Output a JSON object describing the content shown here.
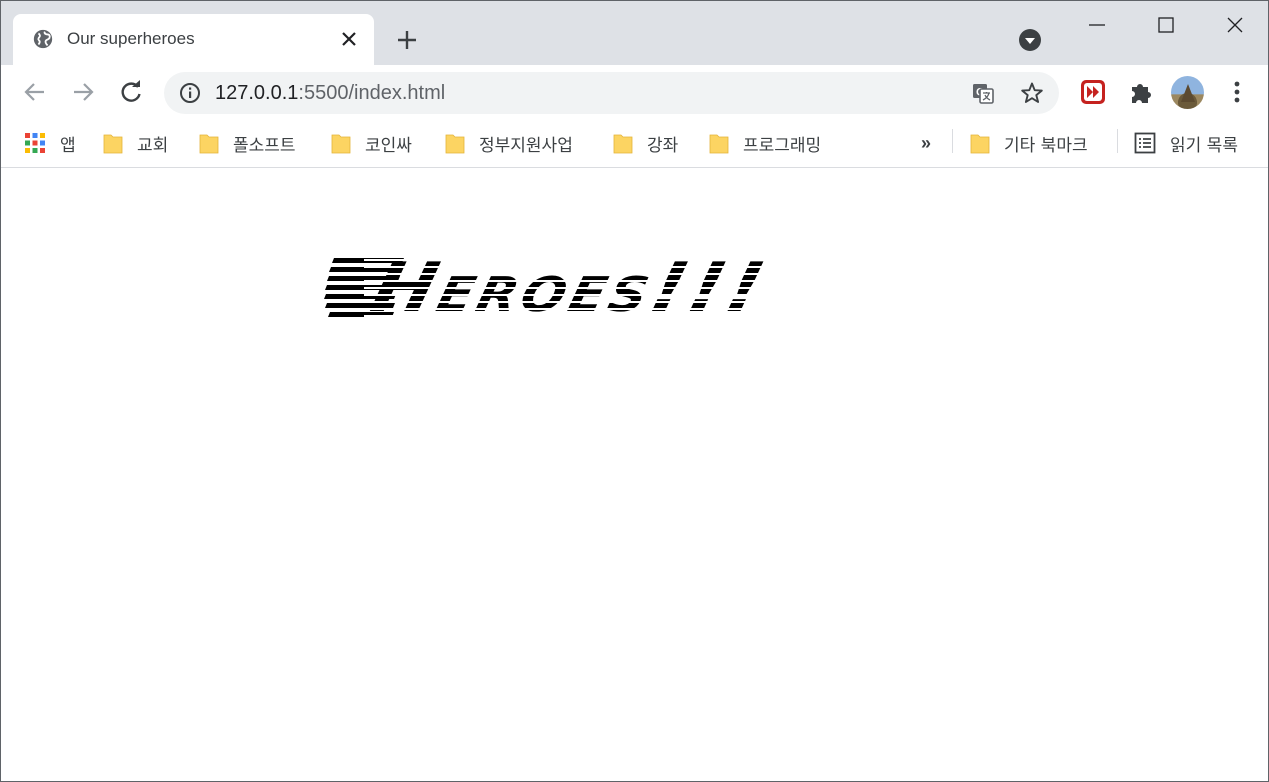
{
  "tab": {
    "title": "Our superheroes",
    "favicon": "globe-icon"
  },
  "window_controls": [
    "minimize-icon",
    "maximize-icon",
    "close-icon"
  ],
  "toolbar": {
    "url_host": "127.0.0.1",
    "url_rest": ":5500/index.html",
    "extensions": [
      "translate-icon",
      "star-icon",
      "video-speed-ext-icon",
      "puzzle-icon",
      "avatar",
      "kebab-menu-icon"
    ]
  },
  "bookmarks": {
    "apps_label": "앱",
    "items": [
      {
        "label": "교회"
      },
      {
        "label": "폴소프트"
      },
      {
        "label": "코인싸"
      },
      {
        "label": "정부지원사업"
      },
      {
        "label": "강좌"
      },
      {
        "label": "프로그래밍"
      }
    ],
    "overflow": "»",
    "other_label": "기타 북마크",
    "reading_list_label": "읽기 목록"
  },
  "page": {
    "heading": "Heroes!!!"
  },
  "colors": {
    "tabstrip": "#dee1e6",
    "omnibox": "#f1f3f4",
    "folder": "#fcd462",
    "ext_red": "#c5221f"
  }
}
